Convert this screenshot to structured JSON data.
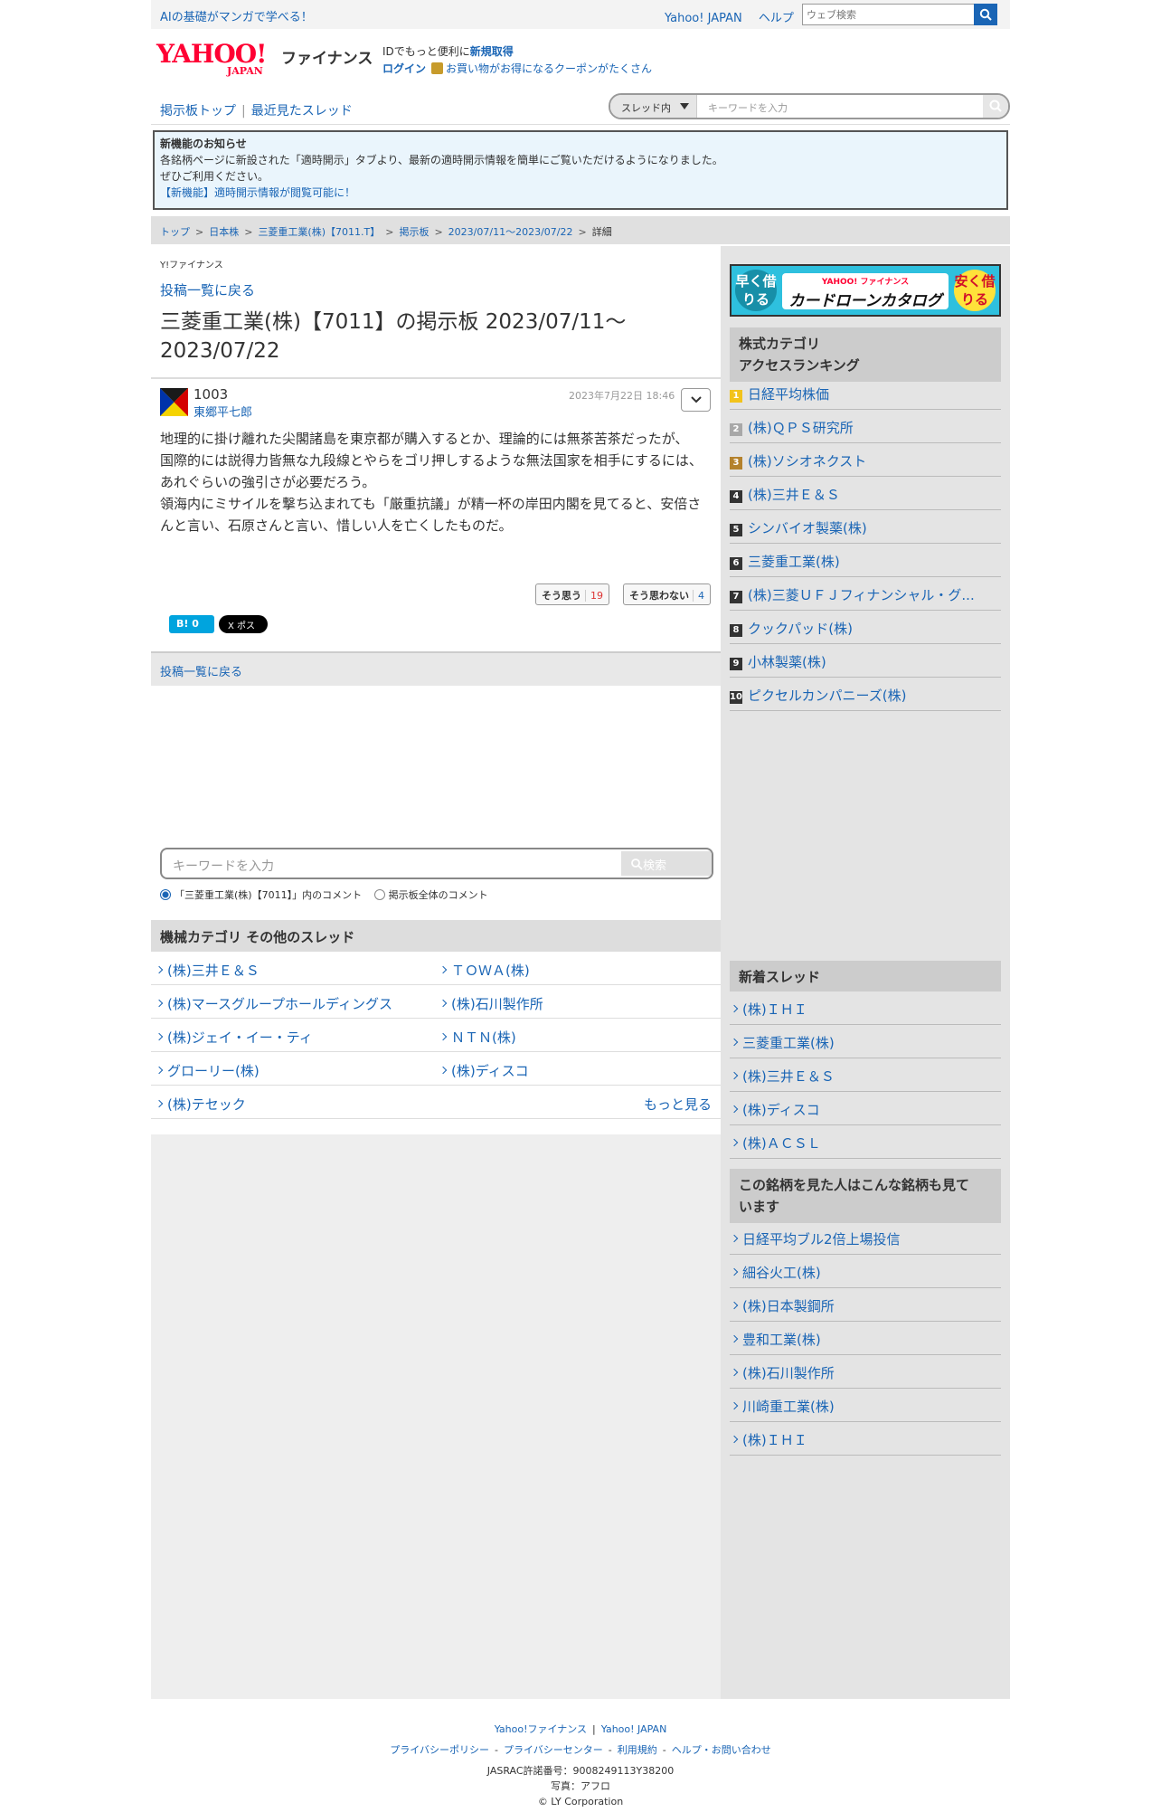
{
  "top": {
    "promo": "AIの基礎がマンガで学べる！",
    "links": [
      "Yahoo! JAPAN",
      "ヘルプ"
    ],
    "search_placeholder": "ウェブ検索"
  },
  "header": {
    "logo_text": "YAHOO!",
    "logo_sub": "JAPAN",
    "finance": "ファイナンス",
    "id_text": "IDでもっと便利に",
    "id_link": "新規取得",
    "login": "ログイン",
    "coupon": "お買い物がお得になるクーポンがたくさん"
  },
  "boardnav": {
    "top": "掲示板トップ",
    "recent": "最近見たスレッド",
    "scope": "スレッド内",
    "placeholder": "キーワードを入力"
  },
  "notice": {
    "title": "新機能のお知らせ",
    "line1": "各銘柄ページに新設された「適時開示」タブより、最新の適時開示情報を簡単にご覧いただけるようになりました。",
    "line2": "ぜひご利用ください。",
    "link": "【新機能】適時開示情報が閲覧可能に！"
  },
  "breadcrumb": [
    "トップ",
    "日本株",
    "三菱重工業(株)【7011.T】",
    "掲示板",
    "2023/07/11〜2023/07/22",
    "詳細"
  ],
  "post": {
    "small_logo": "Y!ファイナンス",
    "back": "投稿一覧に戻る",
    "title": "三菱重工業(株)【7011】の掲示板 2023/07/11〜2023/07/22",
    "number": "1003",
    "author": "東郷平七郎",
    "date": "2023年7月22日 18:46",
    "body": [
      "地理的に掛け離れた尖閣諸島を東京都が購入するとか、理論的には無茶苦茶だったが、",
      "国際的には説得力皆無な九段線とやらをゴリ押しするような無法国家を相手にするには、あれぐらいの強引さが必要だろう。",
      "領海内にミサイルを撃ち込まれても「厳重抗議」が精一杯の岸田内閣を見てると、安倍さんと言い、石原さんと言い、惜しい人を亡くしたものだ。"
    ],
    "agree_label": "そう思う",
    "agree_count": "19",
    "disagree_label": "そう思わない",
    "disagree_count": "4",
    "hatena": "B! 0",
    "x_label": "X ポスト",
    "back2": "投稿一覧に戻る"
  },
  "search": {
    "placeholder": "キーワードを入力",
    "button": "検索",
    "radio1": "「三菱重工業(株)【7011】」内のコメント",
    "radio2": "掲示板全体のコメント"
  },
  "category": {
    "title": "機械カテゴリ その他のスレッド",
    "left": [
      "(株)三井Ｅ＆Ｓ",
      "(株)マースグループホールディングス",
      "(株)ジェイ・イー・ティ",
      "グローリー(株)",
      "(株)テセック"
    ],
    "right": [
      "ＴＯＷＡ(株)",
      "(株)石川製作所",
      "ＮＴＮ(株)",
      "(株)ディスコ"
    ],
    "more": "もっと見る"
  },
  "sidebar": {
    "banner_left": "早く借りる",
    "banner_brand": "YAHOO! ファイナンス",
    "banner_title": "カードローンカタログ",
    "banner_right": "安く借りる",
    "ranking_title": "株式カテゴリ アクセスランキング",
    "ranking_line1": "株式カテゴリ",
    "ranking_line2": "アクセスランキング",
    "ranking": [
      "日経平均株価",
      "(株)ＱＰＳ研究所",
      "(株)ソシオネクスト",
      "(株)三井Ｅ＆Ｓ",
      "シンバイオ製薬(株)",
      "三菱重工業(株)",
      "(株)三菱ＵＦＪフィナンシャル・グ...",
      "クックパッド(株)",
      "小林製薬(株)",
      "ピクセルカンパニーズ(株)"
    ],
    "ranks": [
      "1",
      "2",
      "3",
      "4",
      "5",
      "6",
      "7",
      "8",
      "9",
      "10"
    ],
    "new_title": "新着スレッド",
    "new_threads": [
      "(株)ＩＨＩ",
      "三菱重工業(株)",
      "(株)三井Ｅ＆Ｓ",
      "(株)ディスコ",
      "(株)ＡＣＳＬ"
    ],
    "also_line1": "この銘柄を見た人はこんな銘柄も見て",
    "also_line2": "います",
    "also_viewed": [
      "日経平均ブル2倍上場投信",
      "細谷火工(株)",
      "(株)日本製鋼所",
      "豊和工業(株)",
      "(株)石川製作所",
      "川崎重工業(株)",
      "(株)ＩＨＩ"
    ]
  },
  "footer": {
    "row1": [
      "Yahoo!ファイナンス",
      "Yahoo! JAPAN"
    ],
    "row2": [
      "プライバシーポリシー",
      "プライバシーセンター",
      "利用規約",
      "ヘルプ・お問い合わせ"
    ],
    "jasrac": "JASRAC許諾番号：9008249113Y38200",
    "photo": "写真：アフロ",
    "copyright": "© LY Corporation"
  },
  "colors": {
    "link": "#1a65b5",
    "brand": "#ff0033",
    "notice_bg": "#eaf5fc"
  }
}
